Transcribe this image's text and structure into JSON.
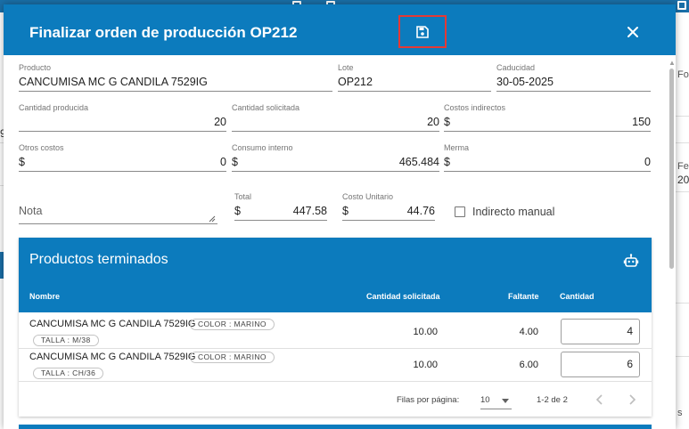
{
  "dialog": {
    "title": "Finalizar orden de producción OP212"
  },
  "fields": {
    "producto": {
      "label": "Producto",
      "value": "CANCUMISA MC G CANDILA 7529IG"
    },
    "lote": {
      "label": "Lote",
      "value": "OP212"
    },
    "caducidad": {
      "label": "Caducidad",
      "value": "30-05-2025"
    },
    "cantidad_producida": {
      "label": "Cantidad producida",
      "value": "20"
    },
    "cantidad_solicitada": {
      "label": "Cantidad solicitada",
      "value": "20"
    },
    "costos_indirectos": {
      "label": "Costos indirectos",
      "currency": "$",
      "value": "150"
    },
    "otros_costos": {
      "label": "Otros costos",
      "currency": "$",
      "value": "0"
    },
    "consumo_interno": {
      "label": "Consumo interno",
      "currency": "$",
      "value": "465.484"
    },
    "merma": {
      "label": "Merma",
      "currency": "$",
      "value": "0"
    },
    "nota": {
      "placeholder": "Nota"
    },
    "total": {
      "label": "Total",
      "currency": "$",
      "value": "447.58"
    },
    "costo_unitario": {
      "label": "Costo Unitario",
      "currency": "$",
      "value": "44.76"
    },
    "indirecto_manual": {
      "label": "Indirecto manual",
      "checked": false
    }
  },
  "table": {
    "title": "Productos terminados",
    "columns": [
      "Nombre",
      "Cantidad solicitada",
      "Faltante",
      "Cantidad"
    ],
    "rows": [
      {
        "name": "CANCUMISA MC G CANDILA 7529IG",
        "chips": [
          "COLOR : MARINO",
          "TALLA : M/38"
        ],
        "solicitada": "10.00",
        "faltante": "4.00",
        "cantidad": "4"
      },
      {
        "name": "CANCUMISA MC G CANDILA 7529IG",
        "chips": [
          "COLOR : MARINO",
          "TALLA : CH/36"
        ],
        "solicitada": "10.00",
        "faltante": "6.00",
        "cantidad": "6"
      }
    ],
    "footer": {
      "rows_per_page_label": "Filas por página:",
      "rows_per_page": "10",
      "range": "1-2 de 2"
    }
  },
  "background": {
    "left_texts": [
      "9"
    ],
    "right_texts": [
      "Fo",
      "Fe",
      "20",
      "s"
    ]
  },
  "colors": {
    "primary": "#0c7bbd",
    "highlight": "#e53935"
  }
}
